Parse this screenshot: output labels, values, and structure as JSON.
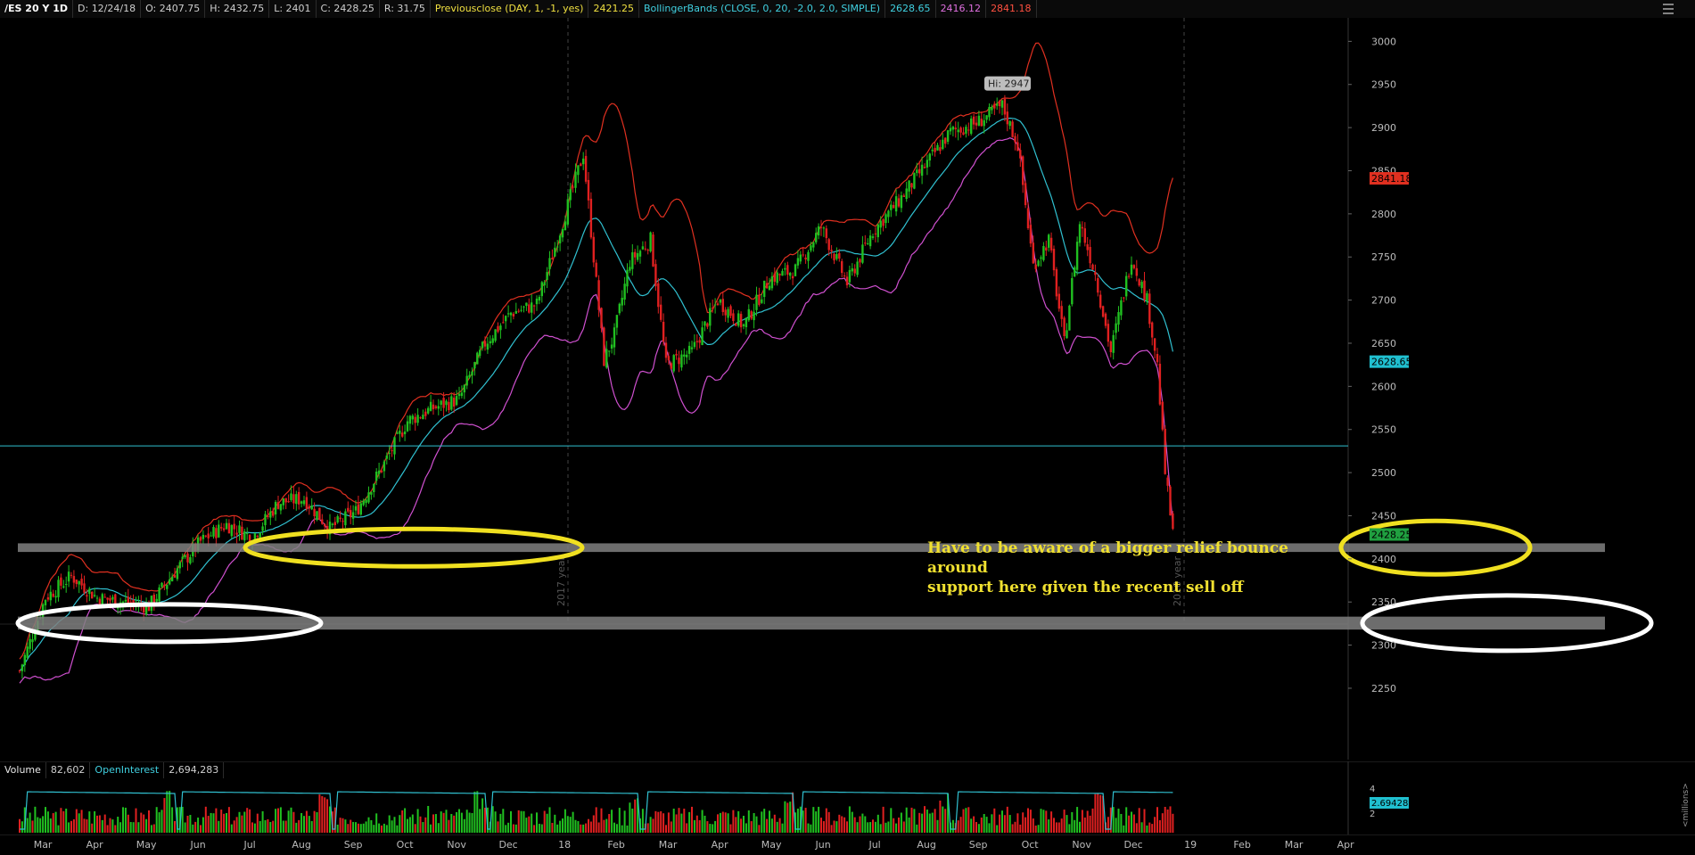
{
  "header": {
    "symbol": "/ES 20 Y 1D",
    "date": "D: 12/24/18",
    "open": "O: 2407.75",
    "high": "H: 2432.75",
    "low": "L: 2401",
    "close": "C: 2428.25",
    "range": "R: 31.75",
    "prev_close_label": "Previousclose (DAY, 1, -1, yes)",
    "prev_close_value": "2421.25",
    "bb_label": "BollingerBands (CLOSE, 0, 20, -2.0, 2.0, SIMPLE)",
    "bb_mid": "2628.65",
    "bb_low": "2416.12",
    "bb_up": "2841.18"
  },
  "chart_data": {
    "type": "candlestick",
    "y_axis": {
      "ticks": [
        2250,
        2300,
        2350,
        2400,
        2450,
        2500,
        2550,
        2600,
        2650,
        2700,
        2750,
        2800,
        2850,
        2900,
        2950,
        3000
      ],
      "range": [
        2190,
        3050
      ]
    },
    "x_axis": {
      "tick_labels": [
        "Mar",
        "Apr",
        "May",
        "Jun",
        "Jul",
        "Aug",
        "Sep",
        "Oct",
        "Nov",
        "Dec",
        "18",
        "Feb",
        "Mar",
        "Apr",
        "May",
        "Jun",
        "Jul",
        "Aug",
        "Sep",
        "Oct",
        "Nov",
        "Dec",
        "19",
        "Feb",
        "Mar",
        "Apr"
      ]
    },
    "year_markers": [
      "2017 year",
      "2018 year"
    ],
    "price_path": [
      {
        "m": 0,
        "p": 2270
      },
      {
        "m": 0.5,
        "p": 2355
      },
      {
        "m": 1,
        "p": 2380
      },
      {
        "m": 1.5,
        "p": 2355
      },
      {
        "m": 2,
        "p": 2350
      },
      {
        "m": 2.5,
        "p": 2345
      },
      {
        "m": 3,
        "p": 2385
      },
      {
        "m": 3.5,
        "p": 2420
      },
      {
        "m": 4,
        "p": 2440
      },
      {
        "m": 4.5,
        "p": 2425
      },
      {
        "m": 5,
        "p": 2465
      },
      {
        "m": 5.5,
        "p": 2470
      },
      {
        "m": 6,
        "p": 2435
      },
      {
        "m": 6.5,
        "p": 2455
      },
      {
        "m": 7,
        "p": 2505
      },
      {
        "m": 7.5,
        "p": 2560
      },
      {
        "m": 8,
        "p": 2575
      },
      {
        "m": 8.5,
        "p": 2585
      },
      {
        "m": 9,
        "p": 2650
      },
      {
        "m": 9.5,
        "p": 2685
      },
      {
        "m": 10,
        "p": 2695
      },
      {
        "m": 10.5,
        "p": 2790
      },
      {
        "m": 10.9,
        "p": 2870
      },
      {
        "m": 11.3,
        "p": 2630
      },
      {
        "m": 11.5,
        "p": 2660
      },
      {
        "m": 11.8,
        "p": 2745
      },
      {
        "m": 12.2,
        "p": 2770
      },
      {
        "m": 12.5,
        "p": 2625
      },
      {
        "m": 13,
        "p": 2640
      },
      {
        "m": 13.5,
        "p": 2700
      },
      {
        "m": 14,
        "p": 2670
      },
      {
        "m": 14.5,
        "p": 2725
      },
      {
        "m": 15,
        "p": 2735
      },
      {
        "m": 15.5,
        "p": 2785
      },
      {
        "m": 16,
        "p": 2720
      },
      {
        "m": 16.5,
        "p": 2780
      },
      {
        "m": 17,
        "p": 2815
      },
      {
        "m": 17.5,
        "p": 2855
      },
      {
        "m": 18,
        "p": 2895
      },
      {
        "m": 18.5,
        "p": 2905
      },
      {
        "m": 19,
        "p": 2925
      },
      {
        "m": 19.3,
        "p": 2880
      },
      {
        "m": 19.6,
        "p": 2740
      },
      {
        "m": 19.9,
        "p": 2770
      },
      {
        "m": 20.2,
        "p": 2650
      },
      {
        "m": 20.5,
        "p": 2790
      },
      {
        "m": 20.8,
        "p": 2730
      },
      {
        "m": 21.1,
        "p": 2640
      },
      {
        "m": 21.5,
        "p": 2750
      },
      {
        "m": 21.8,
        "p": 2700
      },
      {
        "m": 22,
        "p": 2625
      },
      {
        "m": 22.15,
        "p": 2500
      },
      {
        "m": 22.3,
        "p": 2428
      }
    ],
    "bands": {
      "mid_end": 2628.65,
      "lower_end": 2416.12,
      "upper_end": 2841.18
    },
    "high_marker": {
      "label": "Hi: 2947",
      "value": 2947
    },
    "horizontal_line": 2531,
    "support_zones": [
      {
        "low": 2408,
        "high": 2418,
        "color": "#808080"
      },
      {
        "low": 2318,
        "high": 2333,
        "color": "#808080"
      }
    ],
    "price_labels": [
      {
        "text": "2841.18",
        "value": 2841.18,
        "bg": "#e03020",
        "fg": "#000000"
      },
      {
        "text": "2628.65",
        "value": 2628.65,
        "bg": "#20c0d0",
        "fg": "#000000"
      },
      {
        "text": "2428.25",
        "value": 2428.25,
        "bg": "#20a040",
        "fg": "#000000"
      }
    ],
    "colors": {
      "up": "#20c020",
      "down": "#e02020",
      "bb_mid": "#30c0d0",
      "bb_low": "#d050d0",
      "bb_up": "#e03020",
      "ellipse_yellow": "#f0e020",
      "ellipse_white": "#ffffff"
    }
  },
  "annotation": {
    "line1": "Have to be aware of a bigger relief bounce around",
    "line2": "support here given the recent sell off"
  },
  "volume": {
    "label": "Volume",
    "value": "82,602",
    "oi_label": "OpenInterest",
    "oi_value": "2,694,283",
    "axis_ticks": [
      "4",
      "2"
    ],
    "oi_badge": "2.69428",
    "units": "<millions>"
  }
}
